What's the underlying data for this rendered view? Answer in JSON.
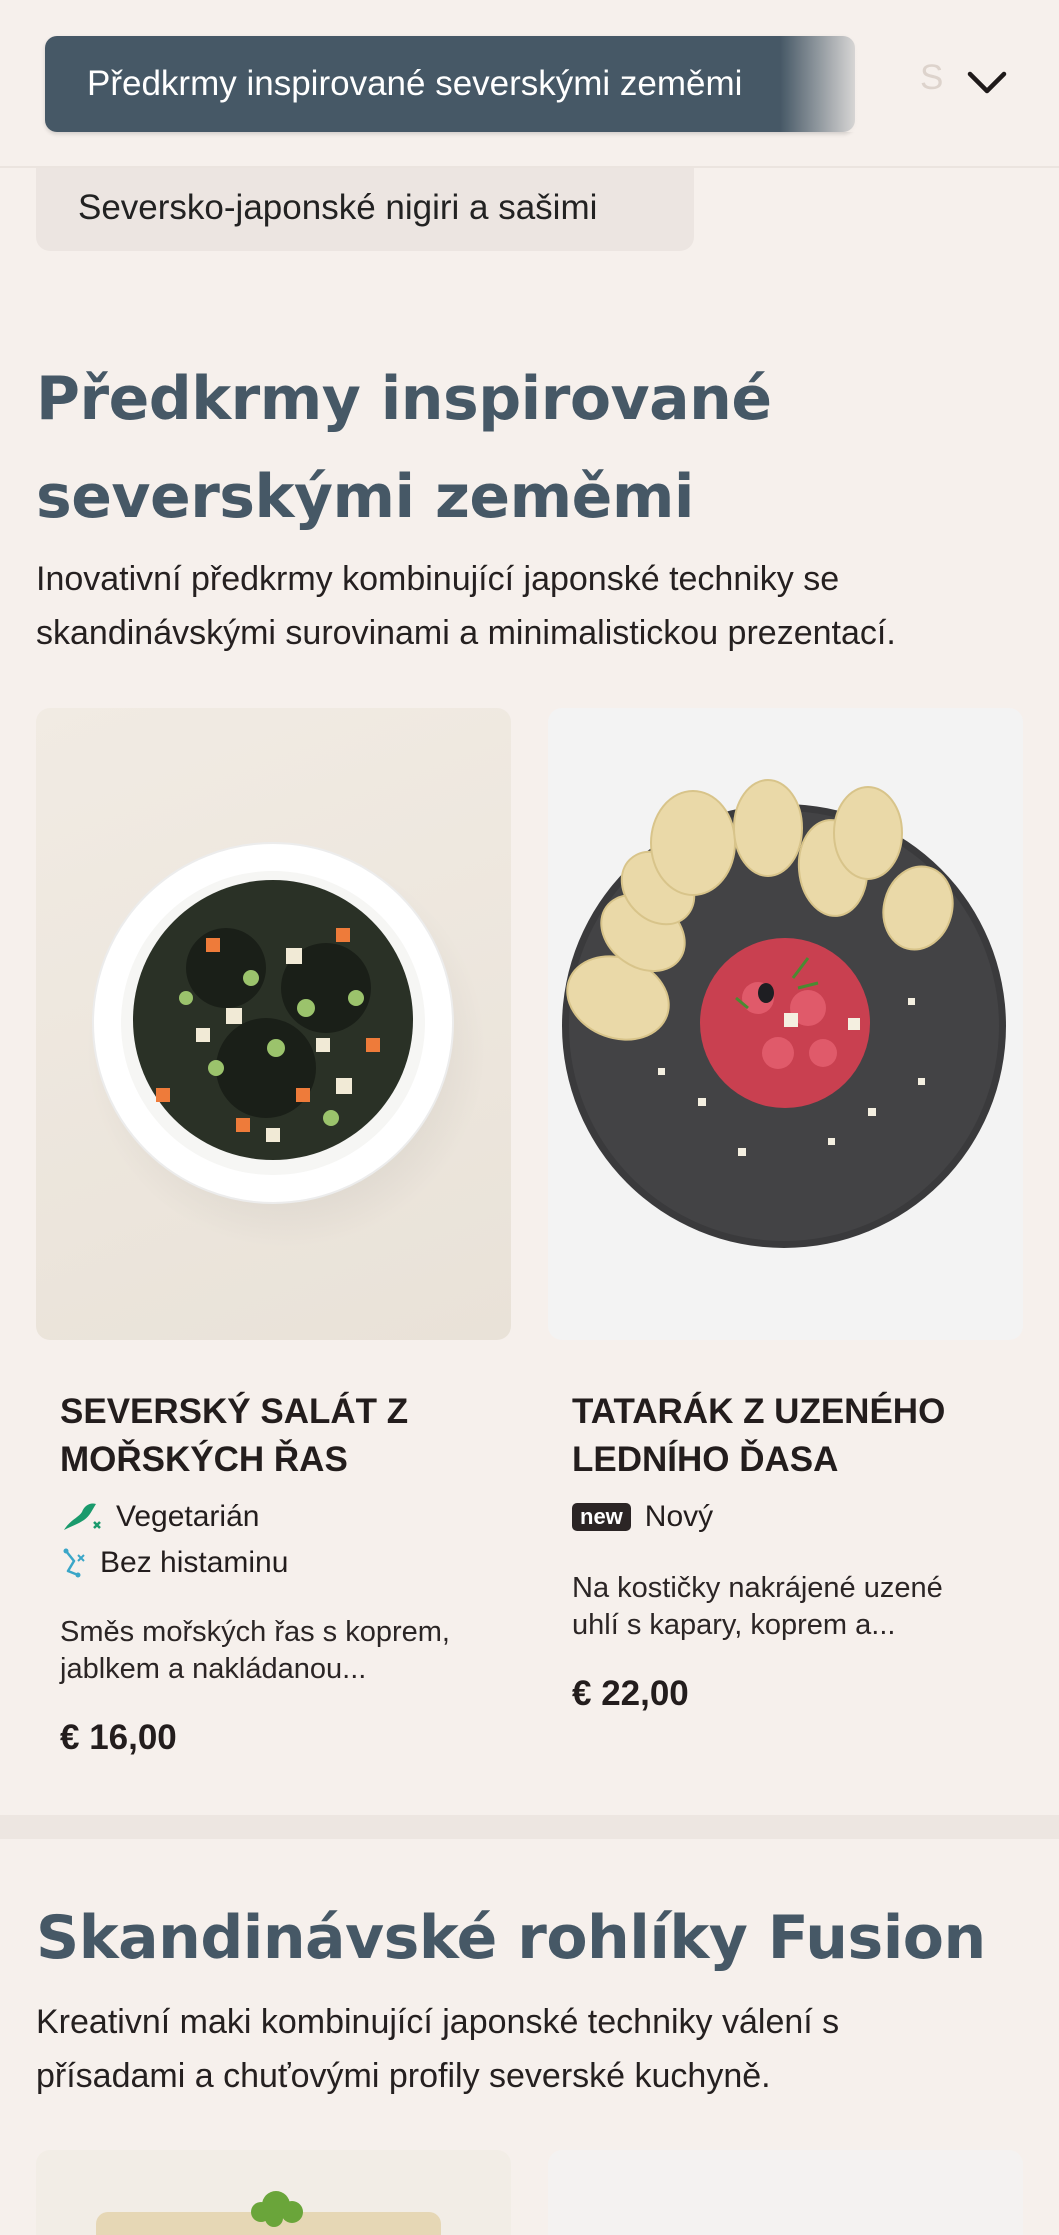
{
  "category_bar": {
    "active": "Předkrmy inspirované severskými zeměmi",
    "next_partial": "S",
    "dropdown_icon": "chevron-down-icon"
  },
  "category_chip": "Seversko-japonské nigiri a sašimi",
  "section1": {
    "title_line1": "Předkrmy inspirované",
    "title_line2": "severskými zeměmi",
    "desc_line1": "Inovativní předkrmy kombinující japonské techniky se",
    "desc_line2": "skandinávskými surovinami a minimalistickou prezentací.",
    "items": [
      {
        "name_line1": "SEVERSKÝ SALÁT Z",
        "name_line2": "MOŘSKÝCH ŘAS",
        "tags": [
          {
            "icon": "vegetarian-icon",
            "label": "Vegetarián"
          },
          {
            "icon": "histamine-free-icon",
            "label": "Bez histaminu"
          }
        ],
        "desc_line1": "Směs mořských řas s koprem,",
        "desc_line2": "jablkem a nakládanou...",
        "price": "€ 16,00"
      },
      {
        "name_line1": "TATARÁK Z UZENÉHO",
        "name_line2": "LEDNÍHO ĎASA",
        "badge": "new",
        "badge_label": "Nový",
        "desc_line1": "Na kostičky nakrájené uzené",
        "desc_line2": "uhlí s kapary, koprem a...",
        "price": "€ 22,00"
      }
    ]
  },
  "section2": {
    "title": "Skandinávské rohlíky Fusion",
    "desc_line1": "Kreativní maki kombinující japonské techniky válení s",
    "desc_line2": "přísadami a chuťovými profily severské kuchyně."
  },
  "colors": {
    "background": "#f6f0ec",
    "accent": "#465866",
    "vegetarian_green": "#1a9a6c",
    "histamine_blue": "#3aa6c8"
  }
}
